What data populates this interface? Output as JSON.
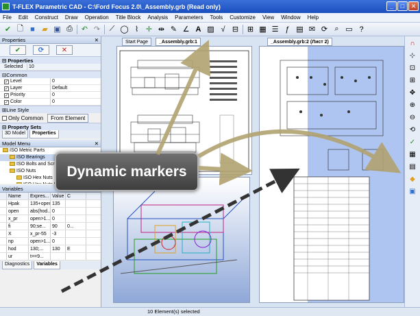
{
  "window": {
    "title": "T-FLEX Parametric CAD - C:\\Ford Focus 2.0\\_Assembly.grb (Read only)"
  },
  "menu": [
    "File",
    "Edit",
    "Construct",
    "Draw",
    "Operation",
    "Title Block",
    "Analysis",
    "Parameters",
    "Tools",
    "Customize",
    "View",
    "Window",
    "Help"
  ],
  "properties": {
    "title": "Properties",
    "section": "Properties",
    "selected": "Selected",
    "selected_count": "10",
    "common": "Common",
    "rows": [
      {
        "key": "Level",
        "value": "0"
      },
      {
        "key": "Layer",
        "value": "Default"
      },
      {
        "key": "Priority",
        "value": "0"
      },
      {
        "key": "Color",
        "value": "0"
      }
    ],
    "line_style": "Line Style",
    "only_common": "Only Common",
    "from_element": "From Element",
    "property_sets": "Property Sets",
    "tabs": [
      "3D Model",
      "Properties"
    ]
  },
  "model_menu": {
    "title": "Model Menu",
    "items": [
      "ISO Metric Parts",
      "ISO Bearings",
      "ISO Bolts and Screws",
      "ISO Nuts",
      "ISO Hex Nuts",
      "ISO Hex Nuts Fine Pitch",
      "ISO Hex Nuts Prevailing Torque"
    ]
  },
  "variables": {
    "title": "Variables",
    "headers": [
      "",
      "Name",
      "Expres...",
      "Value",
      "C"
    ],
    "rows": [
      [
        "",
        "Hpak",
        "135+open",
        "135",
        ""
      ],
      [
        "",
        "open",
        "abs(hod...",
        "0",
        ""
      ],
      [
        "",
        "x_pr",
        "open>1...",
        "0",
        ""
      ],
      [
        "",
        "fi",
        "90;se...",
        "90",
        "0..."
      ],
      [
        "",
        "X",
        "x_pr-55",
        "-3",
        ""
      ],
      [
        "",
        "np",
        "open>1...",
        "0",
        ""
      ],
      [
        "",
        "hod",
        "130;...",
        "130",
        "E"
      ],
      [
        "",
        "ur",
        "t==9...",
        "",
        ""
      ]
    ],
    "tabs": [
      "Diagnostics",
      "Variables"
    ]
  },
  "documents": [
    {
      "tab": "Start Page",
      "tab2": "_Assembly.grb:1"
    },
    {
      "tab": "_Assembly.grb:2 (Лист 2)"
    }
  ],
  "callout": "Dynamic markers",
  "status": "10 Element(s) selected",
  "colors": {
    "accent": "#1b4fbf",
    "highlight": "#9bb7ee",
    "arrow": "#b1a270"
  }
}
